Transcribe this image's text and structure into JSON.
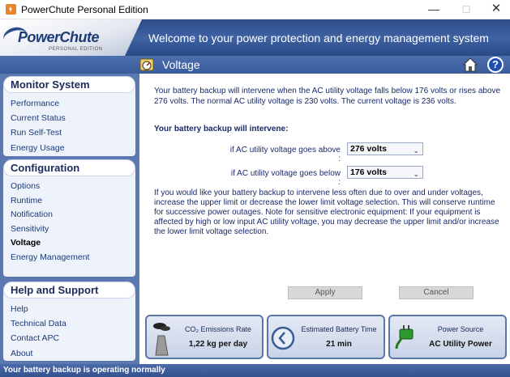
{
  "window": {
    "title": "PowerChute Personal Edition"
  },
  "logo": {
    "name": "PowerChute",
    "edition": "PERSONAL EDITION"
  },
  "banner": {
    "title": "Welcome to your power protection and energy management system"
  },
  "section": {
    "title": "Voltage"
  },
  "sidebar": {
    "groups": [
      {
        "title": "Monitor System",
        "items": [
          "Performance",
          "Current Status",
          "Run Self-Test",
          "Energy Usage"
        ]
      },
      {
        "title": "Configuration",
        "items": [
          "Options",
          "Runtime",
          "Notification",
          "Sensitivity",
          "Voltage",
          "Energy Management"
        ]
      },
      {
        "title": "Help and Support",
        "items": [
          "Help",
          "Technical Data",
          "Contact APC",
          "About"
        ]
      }
    ],
    "active_item": "Voltage"
  },
  "main": {
    "intro": "Your battery backup will intervene when the AC utility voltage falls below 176 volts or rises above 276 volts. The normal AC utility voltage is 230 volts. The current voltage is 236 volts.",
    "intervene_heading": "Your battery backup will intervene:",
    "above_label": "if AC utility voltage goes above :",
    "above_value": "276 volts",
    "below_label": "if AC utility voltage goes below :",
    "below_value": "176 volts",
    "advice": "If you would like your battery backup to intervene less often due to over and under voltages, increase the upper limit or decrease the lower limit voltage selection. This will conserve runtime for successive power outages. Note for sensitive electronic equipment: If your equipment is affected by high or low input AC utility voltage, you may decrease the upper limit and/or increase the lower limit voltage selection.",
    "apply_label": "Apply",
    "cancel_label": "Cancel"
  },
  "panels": {
    "co2": {
      "label": "CO₂ Emissions Rate",
      "value": "1,22 kg per day"
    },
    "battery": {
      "label": "Estimated Battery Time",
      "value": "21 min"
    },
    "power": {
      "label": "Power Source",
      "value": "AC Utility Power"
    }
  },
  "status": {
    "text": "Your battery backup is operating normally"
  },
  "colors": {
    "brand_blue": "#3f62a3",
    "sidebar_blue": "#5b79b0",
    "text_navy": "#1a2a6a"
  }
}
